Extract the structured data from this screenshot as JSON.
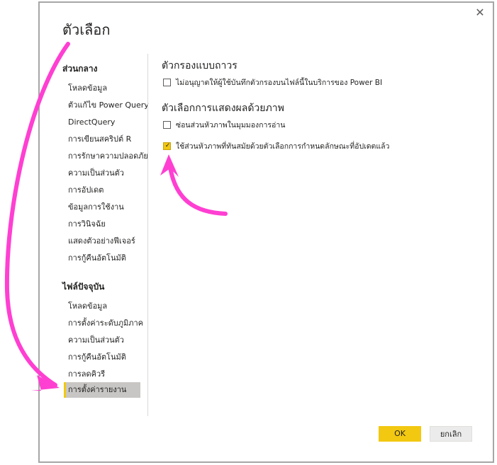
{
  "dialog": {
    "title": "ตัวเลือก",
    "close_icon": "close-icon"
  },
  "sidebar": {
    "global_heading": "ส่วนกลาง",
    "global_items": [
      {
        "label": "โหลดข้อมูล"
      },
      {
        "label": "ตัวแก้ไข Power Query"
      },
      {
        "label": "DirectQuery"
      },
      {
        "label": "การเขียนสคริปต์ R"
      },
      {
        "label": "การรักษาความปลอดภัย"
      },
      {
        "label": "ความเป็นส่วนตัว"
      },
      {
        "label": "การอัปเดต"
      },
      {
        "label": "ข้อมูลการใช้งาน"
      },
      {
        "label": "การวินิจฉัย"
      },
      {
        "label": "แสดงตัวอย่างฟีเจอร์"
      },
      {
        "label": "การกู้คืนอัตโนมัติ"
      }
    ],
    "file_heading": "ไฟล์ปัจจุบัน",
    "file_items": [
      {
        "label": "โหลดข้อมูล"
      },
      {
        "label": "การตั้งค่าระดับภูมิภาค"
      },
      {
        "label": "ความเป็นส่วนตัว"
      },
      {
        "label": "การกู้คืนอัตโนมัติ"
      },
      {
        "label": "การลดคิวรี"
      },
      {
        "label": "การตั้งค่ารายงาน",
        "selected": true
      }
    ]
  },
  "content": {
    "persistent_filters_heading": "ตัวกรองแบบถาวร",
    "persistent_filters_option": {
      "label": "ไม่อนุญาตให้ผู้ใช้บันทึกตัวกรองบนไฟล์นี้ในบริการของ Power BI",
      "checked": false
    },
    "visual_options_heading": "ตัวเลือกการแสดงผลด้วยภาพ",
    "visual_options": [
      {
        "label": "ซ่อนส่วนหัวภาพในมุมมองการอ่าน",
        "checked": false
      },
      {
        "label": "ใช้ส่วนหัวภาพที่ทันสมัยด้วยตัวเลือกการกำหนดลักษณะที่อัปเดตแล้ว",
        "checked": true
      }
    ]
  },
  "buttons": {
    "ok": "OK",
    "cancel": "ยกเลิก"
  },
  "colors": {
    "accent": "#f2c811",
    "annotation_arrow": "#ff3fd2",
    "selected_nav": "#c8c6c4"
  }
}
